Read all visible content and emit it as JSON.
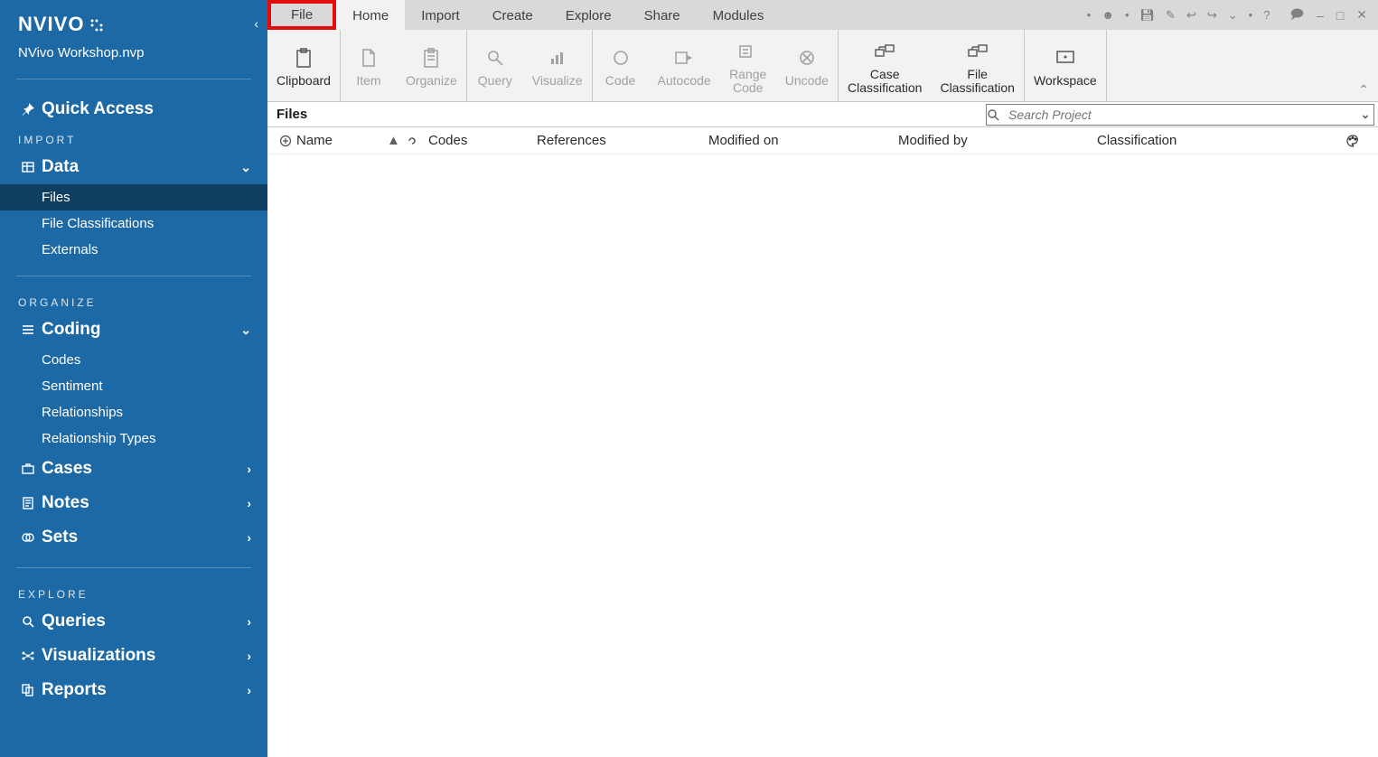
{
  "app": {
    "logo_text": "NVIVO",
    "project_name": "NVivo Workshop.nvp"
  },
  "sidebar": {
    "quick_access": "Quick Access",
    "sections": {
      "import_label": "IMPORT",
      "organize_label": "ORGANIZE",
      "explore_label": "EXPLORE"
    },
    "data": {
      "label": "Data",
      "children": [
        "Files",
        "File Classifications",
        "Externals"
      ]
    },
    "coding": {
      "label": "Coding",
      "children": [
        "Codes",
        "Sentiment",
        "Relationships",
        "Relationship Types"
      ]
    },
    "cases": "Cases",
    "notes": "Notes",
    "sets": "Sets",
    "queries": "Queries",
    "visualizations": "Visualizations",
    "reports": "Reports"
  },
  "tabs": {
    "file": "File",
    "home": "Home",
    "import": "Import",
    "create": "Create",
    "explore": "Explore",
    "share": "Share",
    "modules": "Modules"
  },
  "ribbon": {
    "clipboard": "Clipboard",
    "item": "Item",
    "organize": "Organize",
    "query": "Query",
    "visualize": "Visualize",
    "code": "Code",
    "autocode": "Autocode",
    "range_code": "Range\nCode",
    "uncode": "Uncode",
    "case_classification": "Case\nClassification",
    "file_classification": "File\nClassification",
    "workspace": "Workspace"
  },
  "panel": {
    "title": "Files",
    "search_placeholder": "Search Project"
  },
  "grid": {
    "columns": {
      "name": "Name",
      "codes": "Codes",
      "references": "References",
      "modified_on": "Modified on",
      "modified_by": "Modified by",
      "classification": "Classification"
    }
  }
}
